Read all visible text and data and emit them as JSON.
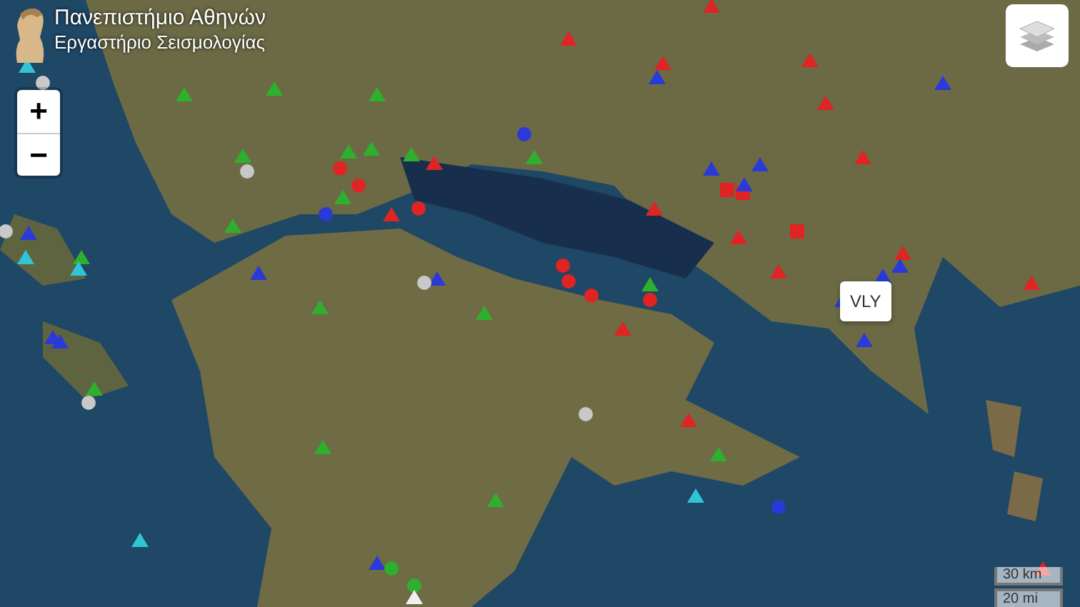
{
  "logo": {
    "title": "Πανεπιστήμιο Αθηνών",
    "subtitle": "Εργαστήριο Σεισμολογίας"
  },
  "zoom_controls": [
    {
      "label": "+"
    },
    {
      "label": "−"
    }
  ],
  "tooltip": {
    "label": "VLY"
  },
  "scale": {
    "metric": "30 km",
    "imperial": "20 mi"
  },
  "markers": [
    {
      "kind": "triangle",
      "color": "#e02424"
    },
    {
      "kind": "triangle",
      "color": "#e02424"
    },
    {
      "kind": "triangle",
      "color": "#e02424"
    },
    {
      "kind": "triangle",
      "color": "#e02424"
    },
    {
      "kind": "triangle",
      "color": "#e02424"
    },
    {
      "kind": "triangle",
      "color": "#e02424"
    },
    {
      "kind": "triangle",
      "color": "#e02424"
    },
    {
      "kind": "triangle",
      "color": "#e02424"
    },
    {
      "kind": "triangle",
      "color": "#e02424"
    },
    {
      "kind": "triangle",
      "color": "#e02424"
    },
    {
      "kind": "triangle",
      "color": "#e02424"
    },
    {
      "kind": "triangle",
      "color": "#e02424"
    },
    {
      "kind": "triangle",
      "color": "#e02424"
    },
    {
      "kind": "triangle",
      "color": "#e02424"
    },
    {
      "kind": "triangle",
      "color": "#e02424"
    },
    {
      "kind": "triangle",
      "color": "#e02424"
    },
    {
      "kind": "square",
      "color": "#e02424"
    },
    {
      "kind": "square",
      "color": "#e02424"
    },
    {
      "kind": "square",
      "color": "#e02424"
    },
    {
      "kind": "circle",
      "color": "#e02424"
    },
    {
      "kind": "circle",
      "color": "#e02424"
    },
    {
      "kind": "circle",
      "color": "#e02424"
    },
    {
      "kind": "circle",
      "color": "#e02424"
    },
    {
      "kind": "circle",
      "color": "#e02424"
    },
    {
      "kind": "circle",
      "color": "#e02424"
    },
    {
      "kind": "circle",
      "color": "#e02424"
    },
    {
      "kind": "triangle",
      "color": "#2a3ad8"
    },
    {
      "kind": "triangle",
      "color": "#2a3ad8"
    },
    {
      "kind": "triangle",
      "color": "#2a3ad8"
    },
    {
      "kind": "triangle",
      "color": "#2a3ad8"
    },
    {
      "kind": "triangle",
      "color": "#2a3ad8"
    },
    {
      "kind": "triangle",
      "color": "#2a3ad8"
    },
    {
      "kind": "triangle",
      "color": "#2a3ad8"
    },
    {
      "kind": "triangle",
      "color": "#2a3ad8"
    },
    {
      "kind": "triangle",
      "color": "#2a3ad8"
    },
    {
      "kind": "triangle",
      "color": "#2a3ad8"
    },
    {
      "kind": "triangle",
      "color": "#2a3ad8"
    },
    {
      "kind": "triangle",
      "color": "#2a3ad8"
    },
    {
      "kind": "triangle",
      "color": "#2a3ad8"
    },
    {
      "kind": "triangle",
      "color": "#2a3ad8"
    },
    {
      "kind": "triangle",
      "color": "#2a3ad8"
    },
    {
      "kind": "circle",
      "color": "#2a3ad8"
    },
    {
      "kind": "circle",
      "color": "#2a3ad8"
    },
    {
      "kind": "circle",
      "color": "#2a3ad8"
    },
    {
      "kind": "triangle",
      "color": "#2eb02e"
    },
    {
      "kind": "triangle",
      "color": "#2eb02e"
    },
    {
      "kind": "triangle",
      "color": "#2eb02e"
    },
    {
      "kind": "triangle",
      "color": "#2eb02e"
    },
    {
      "kind": "triangle",
      "color": "#2eb02e"
    },
    {
      "kind": "triangle",
      "color": "#2eb02e"
    },
    {
      "kind": "triangle",
      "color": "#2eb02e"
    },
    {
      "kind": "triangle",
      "color": "#2eb02e"
    },
    {
      "kind": "triangle",
      "color": "#2eb02e"
    },
    {
      "kind": "triangle",
      "color": "#2eb02e"
    },
    {
      "kind": "triangle",
      "color": "#2eb02e"
    },
    {
      "kind": "triangle",
      "color": "#2eb02e"
    },
    {
      "kind": "triangle",
      "color": "#2eb02e"
    },
    {
      "kind": "triangle",
      "color": "#2eb02e"
    },
    {
      "kind": "triangle",
      "color": "#2eb02e"
    },
    {
      "kind": "triangle",
      "color": "#2eb02e"
    },
    {
      "kind": "triangle",
      "color": "#2eb02e"
    },
    {
      "kind": "triangle",
      "color": "#2eb02e"
    },
    {
      "kind": "circle",
      "color": "#2eb02e"
    },
    {
      "kind": "circle",
      "color": "#2eb02e"
    },
    {
      "kind": "triangle",
      "color": "#30c4d4"
    },
    {
      "kind": "triangle",
      "color": "#30c4d4"
    },
    {
      "kind": "triangle",
      "color": "#30c4d4"
    },
    {
      "kind": "triangle",
      "color": "#30c4d4"
    },
    {
      "kind": "triangle",
      "color": "#30c4d4"
    },
    {
      "kind": "circle",
      "color": "#c8c8c8"
    },
    {
      "kind": "circle",
      "color": "#c8c8c8"
    },
    {
      "kind": "circle",
      "color": "#c8c8c8"
    },
    {
      "kind": "circle",
      "color": "#c8c8c8"
    },
    {
      "kind": "circle",
      "color": "#c8c8c8"
    },
    {
      "kind": "circle",
      "color": "#c8c8c8"
    },
    {
      "kind": "triangle",
      "color": "#f0f0f0"
    }
  ]
}
